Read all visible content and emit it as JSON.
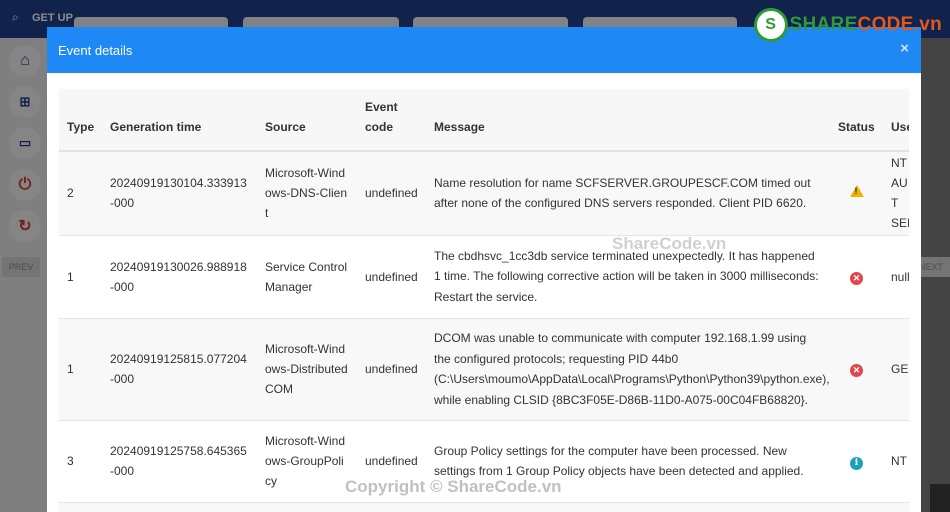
{
  "app": {
    "title": "GET UP"
  },
  "pager": {
    "prev": "PREV",
    "next": "NEXT"
  },
  "modal": {
    "title": "Event details",
    "close": "×",
    "columns": {
      "type": "Type",
      "generation_time": "Generation time",
      "source": "Source",
      "event_code": "Event code",
      "message": "Message",
      "status": "Status",
      "user": "Use"
    },
    "rows": [
      {
        "type": "2",
        "generation_time": "20240919130104.333913-000",
        "source": "Microsoft-Windows-DNS-Client",
        "event_code": "undefined",
        "message": "Name resolution for name SCFSERVER.GROUPESCF.COM timed out after none of the configured DNS servers responded. Client PID 6620.",
        "status": "warning",
        "user": "NT AUT SEI"
      },
      {
        "type": "1",
        "generation_time": "20240919130026.988918-000",
        "source": "Service Control Manager",
        "event_code": "undefined",
        "message": "The cbdhsvc_1cc3db service terminated unexpectedly. It has happened 1 time. The following corrective action will be taken in 3000 milliseconds: Restart the service.",
        "status": "error",
        "user": "null"
      },
      {
        "type": "1",
        "generation_time": "20240919125815.077204-000",
        "source": "Microsoft-Windows-DistributedCOM",
        "event_code": "undefined",
        "message": "DCOM was unable to communicate with computer 192.168.1.99 using the configured protocols; requesting PID 44b0 (C:\\Users\\moumo\\AppData\\Local\\Programs\\Python\\Python39\\python.exe), while enabling CLSID {8BC3F05E-D86B-11D0-A075-00C04FB68820}.",
        "status": "error",
        "user": "GE"
      },
      {
        "type": "3",
        "generation_time": "20240919125758.645365-000",
        "source": "Microsoft-Windows-GroupPolicy",
        "event_code": "undefined",
        "message": "Group Policy settings for the computer have been processed. New settings from 1 Group Policy objects have been detected and applied.",
        "status": "info",
        "user": "NT"
      }
    ]
  },
  "watermarks": {
    "logo_text_a": "SHARE",
    "logo_text_b": "CODE.vn",
    "center": "ShareCode.vn",
    "bottom": "Copyright © ShareCode.vn"
  },
  "colors": {
    "header_blue": "#1e88f5",
    "warning": "#f0b400",
    "error": "#e0474c",
    "info": "#1ba2b8"
  }
}
